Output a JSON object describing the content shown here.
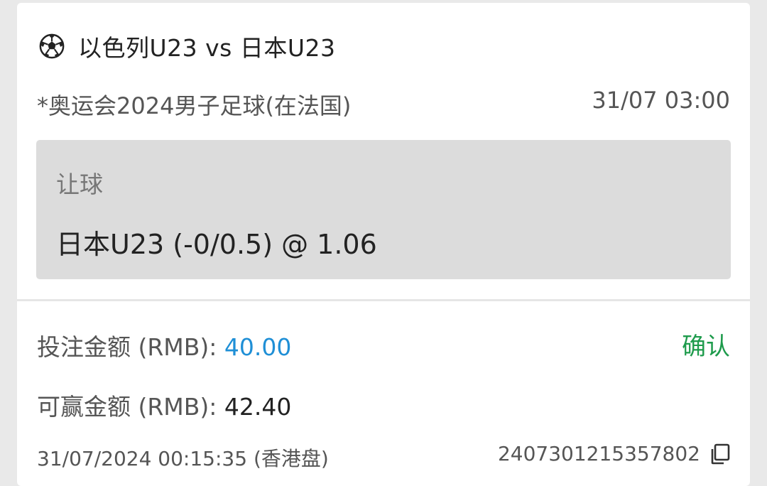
{
  "match": {
    "icon": "soccer-ball-icon",
    "title": "以色列U23 vs 日本U23",
    "league": "*奥运会2024男子足球(在法国)",
    "kickoff": "31/07 03:00"
  },
  "bet": {
    "market": "让球",
    "selection": "日本U23 (-0/0.5) @ 1.06"
  },
  "stake": {
    "label": "投注金额 (RMB): ",
    "value": "40.00",
    "confirm_label": "确认"
  },
  "winnings": {
    "label": "可赢金额 (RMB): ",
    "value": "42.40"
  },
  "footer": {
    "timestamp": "31/07/2024 00:15:35 (香港盘)",
    "ticket_id": "2407301215357802",
    "copy_icon": "copy-icon"
  },
  "colors": {
    "background": "#e9e9e9",
    "card": "#ffffff",
    "bet_box": "#dcdcdc",
    "stake_value": "#1f8fd6",
    "confirm": "#1e9b4c"
  }
}
